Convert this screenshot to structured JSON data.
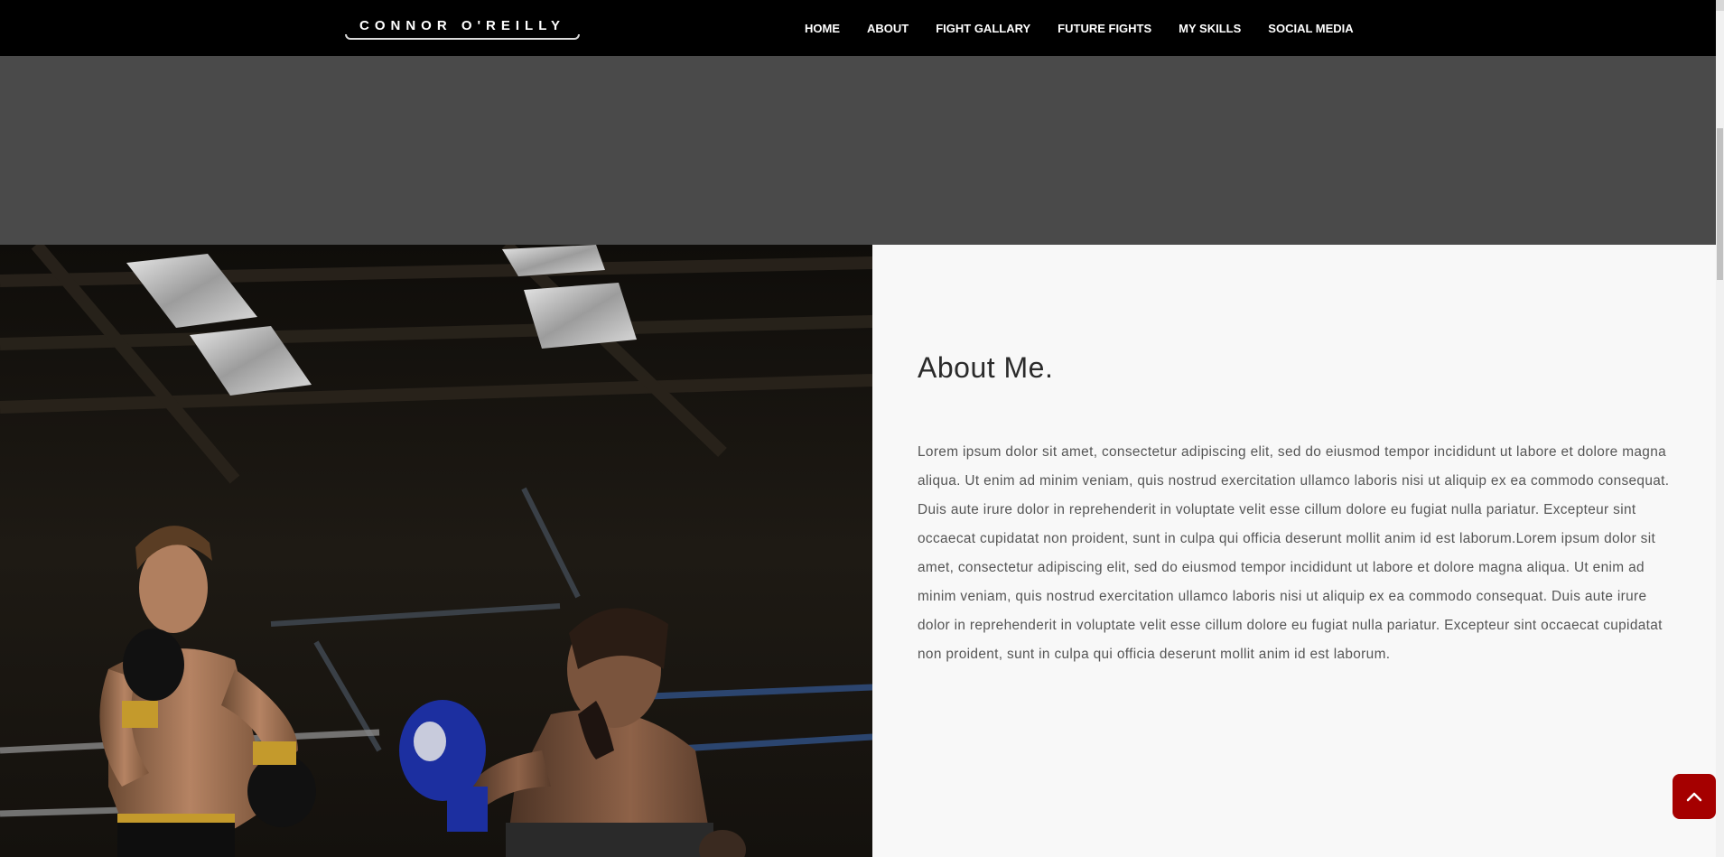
{
  "brand": {
    "name": "CONNOR O'REILLY"
  },
  "nav": {
    "items": [
      {
        "label": "HOME"
      },
      {
        "label": "ABOUT"
      },
      {
        "label": "FIGHT GALLARY"
      },
      {
        "label": "FUTURE FIGHTS"
      },
      {
        "label": "MY SKILLS"
      },
      {
        "label": "SOCIAL MEDIA"
      }
    ]
  },
  "about": {
    "title": "About Me.",
    "body": "Lorem ipsum dolor sit amet, consectetur adipiscing elit, sed do eiusmod tempor incididunt ut labore et dolore magna aliqua. Ut enim ad minim veniam, quis nostrud exercitation ullamco laboris nisi ut aliquip ex ea commodo consequat. Duis aute irure dolor in reprehenderit in voluptate velit esse cillum dolore eu fugiat nulla pariatur. Excepteur sint occaecat cupidatat non proident, sunt in culpa qui officia deserunt mollit anim id est laborum.Lorem ipsum dolor sit amet, consectetur adipiscing elit, sed do eiusmod tempor incididunt ut labore et dolore magna aliqua. Ut enim ad minim veniam, quis nostrud exercitation ullamco laboris nisi ut aliquip ex ea commodo consequat. Duis aute irure dolor in reprehenderit in voluptate velit esse cillum dolore eu fugiat nulla pariatur. Excepteur sint occaecat cupidatat non proident, sunt in culpa qui officia deserunt mollit anim id est laborum."
  },
  "photo": {
    "subject": "kickboxing-match"
  },
  "icons": {
    "back_to_top": "chevron-up-icon"
  },
  "colors": {
    "navbar": "#000000",
    "hero_band": "#4a4a4a",
    "about_bg": "#f8f8f8",
    "accent": "#a50000"
  }
}
